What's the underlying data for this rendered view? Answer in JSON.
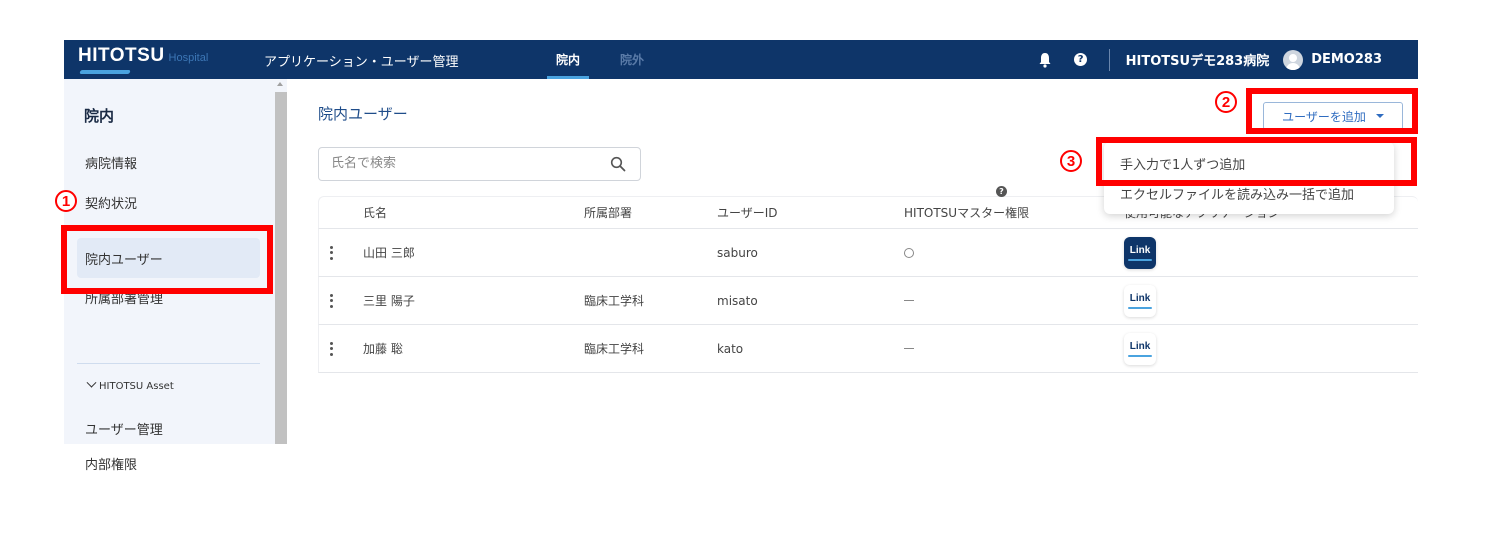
{
  "header": {
    "logo_main": "HITOTSU",
    "logo_sub": "Hospital",
    "app_title": "アプリケーション・ユーザー管理",
    "tabs": [
      {
        "label": "院内",
        "active": true
      },
      {
        "label": "院外",
        "active": false
      }
    ],
    "hospital_name": "HITOTSUデモ283病院",
    "user_name": "DEMO283",
    "help_glyph": "?",
    "icons": {
      "notification": "bell-icon",
      "help": "help-icon",
      "avatar": "user-avatar-icon"
    }
  },
  "sidebar": {
    "title": "院内",
    "items": [
      {
        "label": "病院情報",
        "active": false
      },
      {
        "label": "契約状況",
        "active": false
      },
      {
        "label": "院内ユーザー",
        "active": true
      },
      {
        "label": "所属部署管理",
        "active": false
      }
    ],
    "group": {
      "label": "HITOTSU Asset",
      "expanded": true,
      "caret": "⌄"
    },
    "group_items": [
      {
        "label": "ユーザー管理"
      },
      {
        "label": "内部権限"
      }
    ]
  },
  "main": {
    "title": "院内ユーザー",
    "search": {
      "placeholder": "氏名で検索",
      "value": ""
    },
    "add_button": {
      "label": "ユーザーを追加"
    },
    "dropdown": {
      "items": [
        {
          "label": "手入力で1人ずつ追加"
        },
        {
          "label": "エクセルファイルを読み込み一括で追加"
        }
      ]
    },
    "table": {
      "columns": [
        "氏名",
        "所属部署",
        "ユーザーID",
        "HITOTSUマスター権限",
        "使用可能なアプリケーション"
      ],
      "master_help": "?",
      "rows": [
        {
          "name": "山田 三郎",
          "dept": "",
          "user_id": "saburo",
          "master": "○",
          "app": "Link",
          "app_style": "dark"
        },
        {
          "name": "三里 陽子",
          "dept": "臨床工学科",
          "user_id": "misato",
          "master": "—",
          "app": "Link",
          "app_style": "light"
        },
        {
          "name": "加藤 聡",
          "dept": "臨床工学科",
          "user_id": "kato",
          "master": "—",
          "app": "Link",
          "app_style": "light"
        }
      ]
    }
  },
  "annotations": [
    {
      "number": "1",
      "label": "①",
      "target": "sidebar-item-院内ユーザー"
    },
    {
      "number": "2",
      "label": "②",
      "target": "add-user-button"
    },
    {
      "number": "3",
      "label": "③",
      "target": "dropdown-item-manual"
    }
  ],
  "colors": {
    "header_bg": "#0e3569",
    "accent": "#4aa3df",
    "annotation": "#ff0000",
    "sidebar_bg": "#f2f5fb"
  }
}
